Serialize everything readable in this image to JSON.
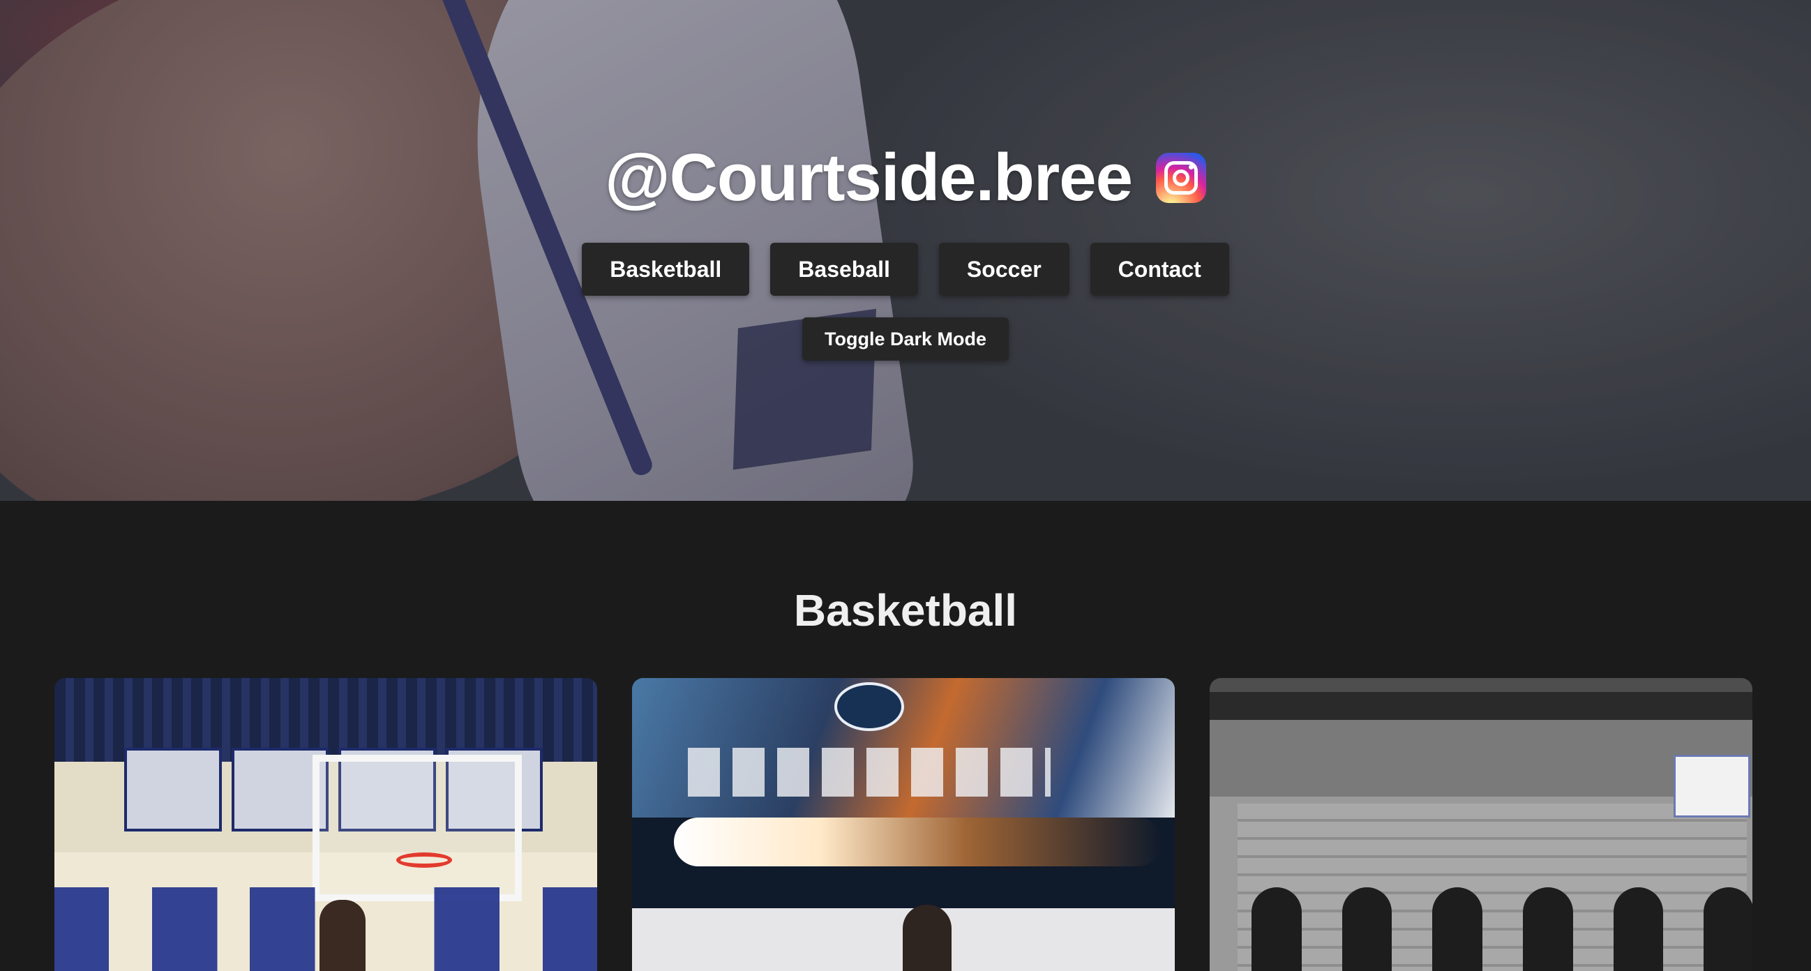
{
  "header": {
    "handle": "@Courtside.bree",
    "social_icon": "instagram-icon"
  },
  "nav": {
    "items": [
      {
        "label": "Basketball"
      },
      {
        "label": "Baseball"
      },
      {
        "label": "Soccer"
      },
      {
        "label": "Contact"
      }
    ],
    "toggle_label": "Toggle Dark Mode"
  },
  "section": {
    "title": "Basketball"
  },
  "colors": {
    "page_background": "#1b1b1b",
    "button_background": "#262626",
    "title_text": "#efefef"
  }
}
